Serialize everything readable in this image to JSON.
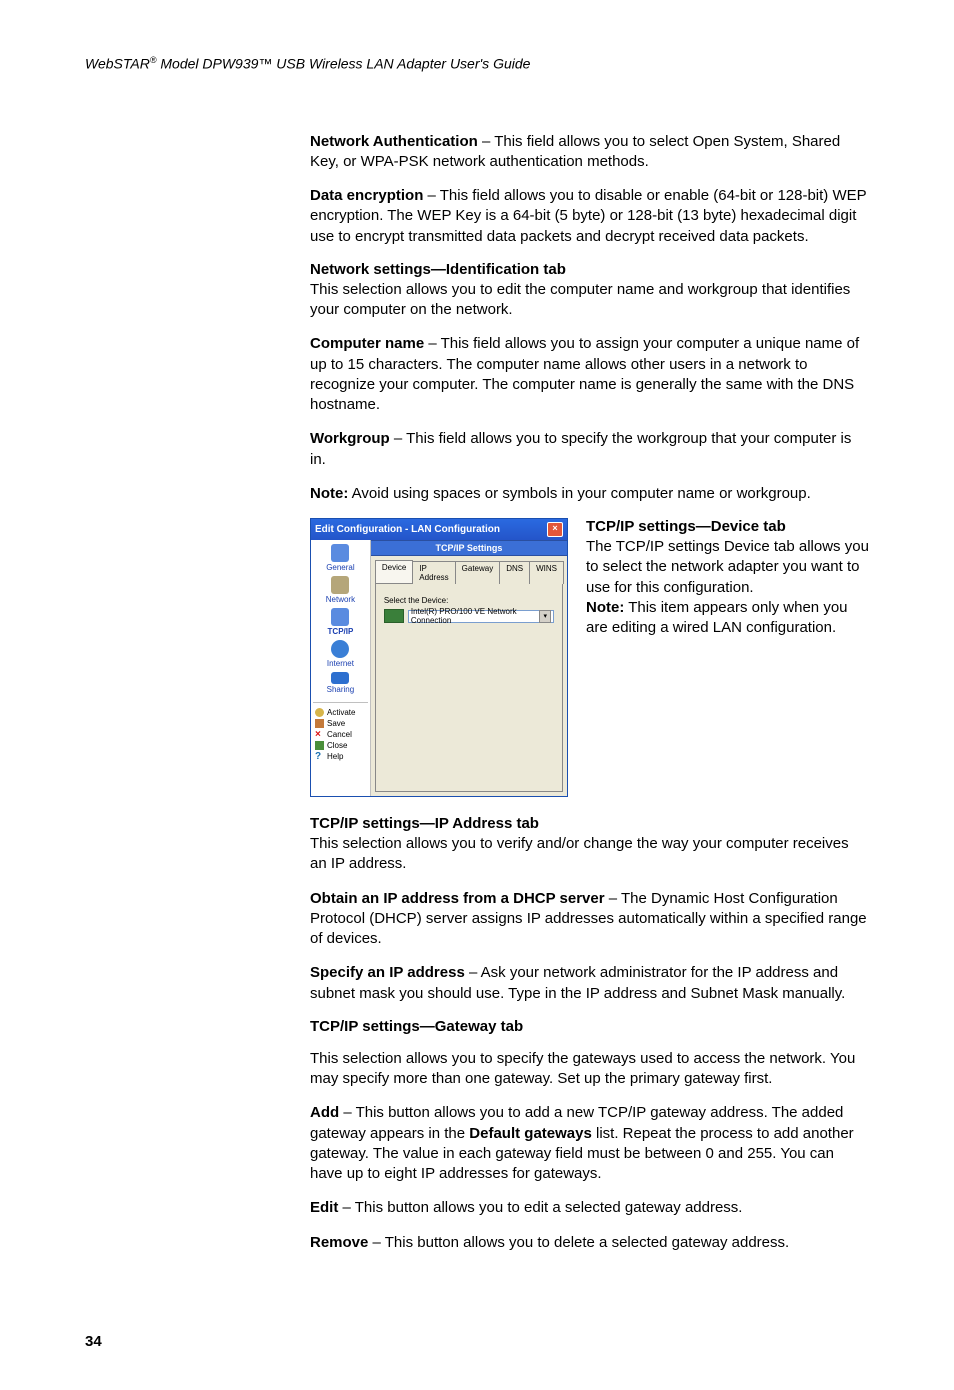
{
  "header": {
    "brand": "WebSTAR",
    "reg": "®",
    "rest": " Model DPW939™ USB Wireless LAN Adapter User's Guide"
  },
  "p1": {
    "label": "Network Authentication",
    "text": " – This field allows you to select Open System, Shared Key, or WPA-PSK network authentication methods."
  },
  "p2": {
    "label": "Data encryption",
    "text": " – This field allows you to disable or enable (64-bit or 128-bit) WEP encryption. The WEP Key is a 64-bit (5 byte) or 128-bit (13 byte) hexadecimal digit use to encrypt transmitted data packets and decrypt received data packets."
  },
  "h3": "Network settings—Identification tab",
  "p3": "This selection allows you to edit the computer name and workgroup that identifies your computer on the network.",
  "p4": {
    "label": "Computer name",
    "text": " – This field allows you to assign your computer a unique name of up to 15 characters. The computer name allows other users in a network to recognize your computer. The computer name is generally the same with the DNS hostname."
  },
  "p5": {
    "label": "Workgroup",
    "text": " – This field allows you to specify the workgroup that your computer is in."
  },
  "p6": {
    "label": "Note:",
    "text": " Avoid using spaces or symbols in your computer name or workgroup."
  },
  "h7": "TCP/IP settings—Device tab",
  "p7a": "The TCP/IP settings Device tab allows you to select the network adapter you want to use for this configuration.",
  "p7b": {
    "label": "Note:",
    "text": " This item appears only when you are editing a wired LAN configuration."
  },
  "h8": "TCP/IP settings—IP Address tab",
  "p8": "This selection allows you to verify and/or change the way your computer receives an IP address.",
  "p9": {
    "label": "Obtain an IP address from a DHCP server",
    "text": " – The Dynamic Host Configuration Protocol (DHCP) server assigns IP addresses automatically within a specified range of devices."
  },
  "p10": {
    "label": "Specify an IP address",
    "text": " – Ask your network administrator for the IP address and subnet mask you should use. Type in the IP address and Subnet Mask manually."
  },
  "h11": "TCP/IP settings—Gateway tab",
  "p11": "This selection allows you to specify the gateways used to access the network. You may specify more than one gateway. Set up the primary gateway first.",
  "p12": {
    "label": "Add",
    "pre": " – This button allows you to add a new TCP/IP gateway address. The added gateway appears in the ",
    "bold2": "Default gateways",
    "post": " list. Repeat the process to add another gateway. The value in each gateway field must be between 0 and 255. You can have up to eight IP addresses for gateways."
  },
  "p13": {
    "label": "Edit",
    "text": " – This button allows you to edit a selected gateway address."
  },
  "p14": {
    "label": "Remove",
    "text": " – This button allows you to delete a selected gateway address."
  },
  "pagenum": "34",
  "win": {
    "title": "Edit Configuration - LAN Configuration",
    "banner": "TCP/IP Settings",
    "side": {
      "general": "General",
      "network": "Network",
      "tcpip": "TCP/IP",
      "internet": "Internet",
      "sharing": "Sharing",
      "activate": "Activate",
      "save": "Save",
      "cancel": "Cancel",
      "close": "Close",
      "help": "Help"
    },
    "tabs": [
      "Device",
      "IP Address",
      "Gateway",
      "DNS",
      "WINS"
    ],
    "fieldlabel": "Select the Device:",
    "device_selected": "Intel(R) PRO/100 VE Network Connection"
  }
}
